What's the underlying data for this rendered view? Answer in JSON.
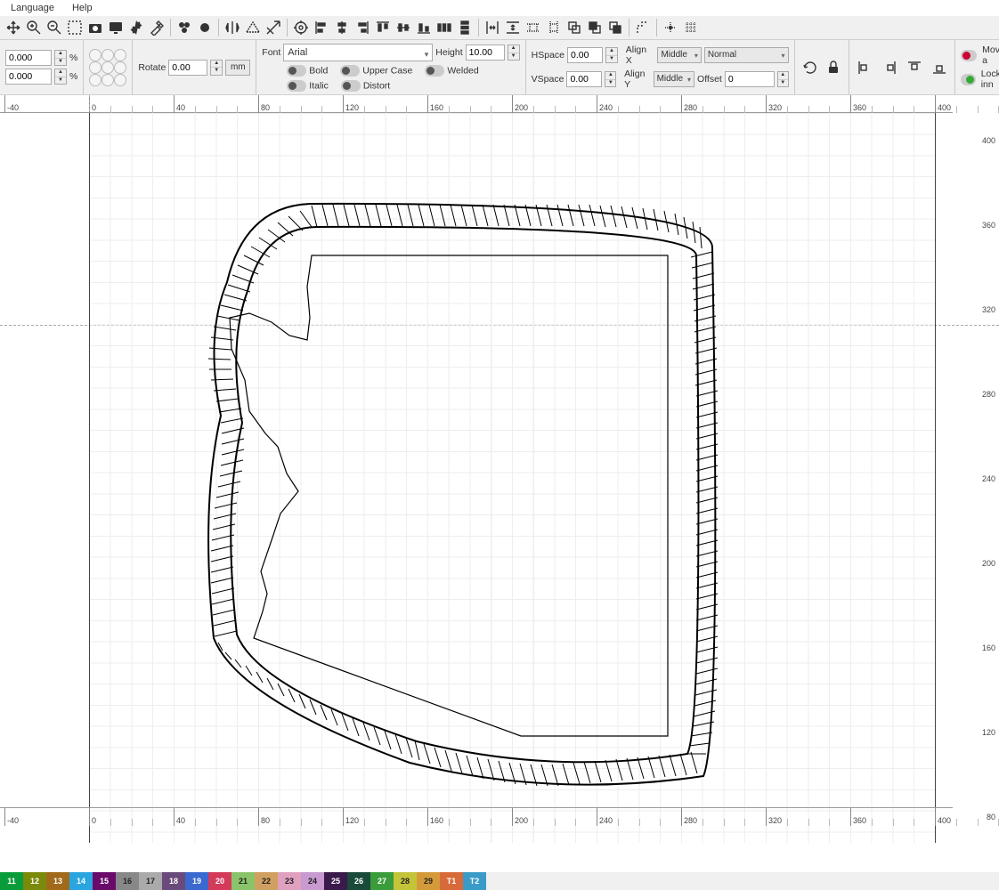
{
  "menu": {
    "language": "Language",
    "help": "Help"
  },
  "toolbar": {
    "icons": [
      "move",
      "zoom-in",
      "zoom-out",
      "zoom-sel",
      "camera",
      "screen",
      "gear",
      "tools",
      "group",
      "ungroup",
      "flip-h",
      "flip-v",
      "rotate-cw",
      "center",
      "align-l",
      "align-c",
      "align-r",
      "align-t",
      "align-m",
      "align-b",
      "dist-h",
      "dist-v",
      "dist-l",
      "dist-c",
      "dist-r",
      "spread",
      "same-w",
      "same-h"
    ]
  },
  "transform": {
    "x": "0.000",
    "y": "0.000",
    "pct": "%",
    "rotate_label": "Rotate",
    "rotate": "0.00",
    "unit": "mm"
  },
  "font": {
    "label": "Font",
    "name": "Arial",
    "height_label": "Height",
    "height": "10.00",
    "bold": "Bold",
    "upper": "Upper Case",
    "welded": "Welded",
    "italic": "Italic",
    "distort": "Distort"
  },
  "spacing": {
    "hspace_label": "HSpace",
    "hspace": "0.00",
    "vspace_label": "VSpace",
    "vspace": "0.00",
    "alignx_label": "Align X",
    "alignx": "Middle",
    "aligny_label": "Align Y",
    "aligny": "Middle",
    "mode": "Normal",
    "offset_label": "Offset",
    "offset": "0"
  },
  "options": {
    "move_all": "Move a",
    "lock_inn": "Lock inn"
  },
  "ruler_h": {
    "neg40": "-40",
    "values": [
      "0",
      "40",
      "80",
      "120",
      "160",
      "200",
      "240",
      "280",
      "320",
      "360",
      "400"
    ]
  },
  "ruler_v": {
    "values": [
      "400",
      "360",
      "320",
      "280",
      "240",
      "200",
      "160",
      "120",
      "80"
    ]
  },
  "ruler_h_bottom": {
    "neg40": "-40",
    "values": [
      "0",
      "40",
      "80",
      "120",
      "160",
      "200",
      "240",
      "280",
      "320",
      "360",
      "400"
    ]
  },
  "swatches": [
    {
      "n": "11",
      "c": "#0a9c3a"
    },
    {
      "n": "12",
      "c": "#7a8a0a"
    },
    {
      "n": "13",
      "c": "#a06a1a"
    },
    {
      "n": "14",
      "c": "#2aa5e0"
    },
    {
      "n": "15",
      "c": "#6a0a6a"
    },
    {
      "n": "16",
      "c": "#888888",
      "d": true
    },
    {
      "n": "17",
      "c": "#aaaaaa",
      "d": true
    },
    {
      "n": "18",
      "c": "#6a4a7a"
    },
    {
      "n": "19",
      "c": "#3a6ad0"
    },
    {
      "n": "20",
      "c": "#d43a5a"
    },
    {
      "n": "21",
      "c": "#8ac46a",
      "d": true
    },
    {
      "n": "22",
      "c": "#d0a060",
      "d": true
    },
    {
      "n": "23",
      "c": "#e0a0c0",
      "d": true
    },
    {
      "n": "24",
      "c": "#c89ad0",
      "d": true
    },
    {
      "n": "25",
      "c": "#3a1a4a"
    },
    {
      "n": "26",
      "c": "#1a4a3a"
    },
    {
      "n": "27",
      "c": "#3a9c3a"
    },
    {
      "n": "28",
      "c": "#c4c43a",
      "d": true
    },
    {
      "n": "29",
      "c": "#d49a3a",
      "d": true
    },
    {
      "n": "T1",
      "c": "#d86a3a"
    },
    {
      "n": "T2",
      "c": "#3a9ac8"
    }
  ]
}
